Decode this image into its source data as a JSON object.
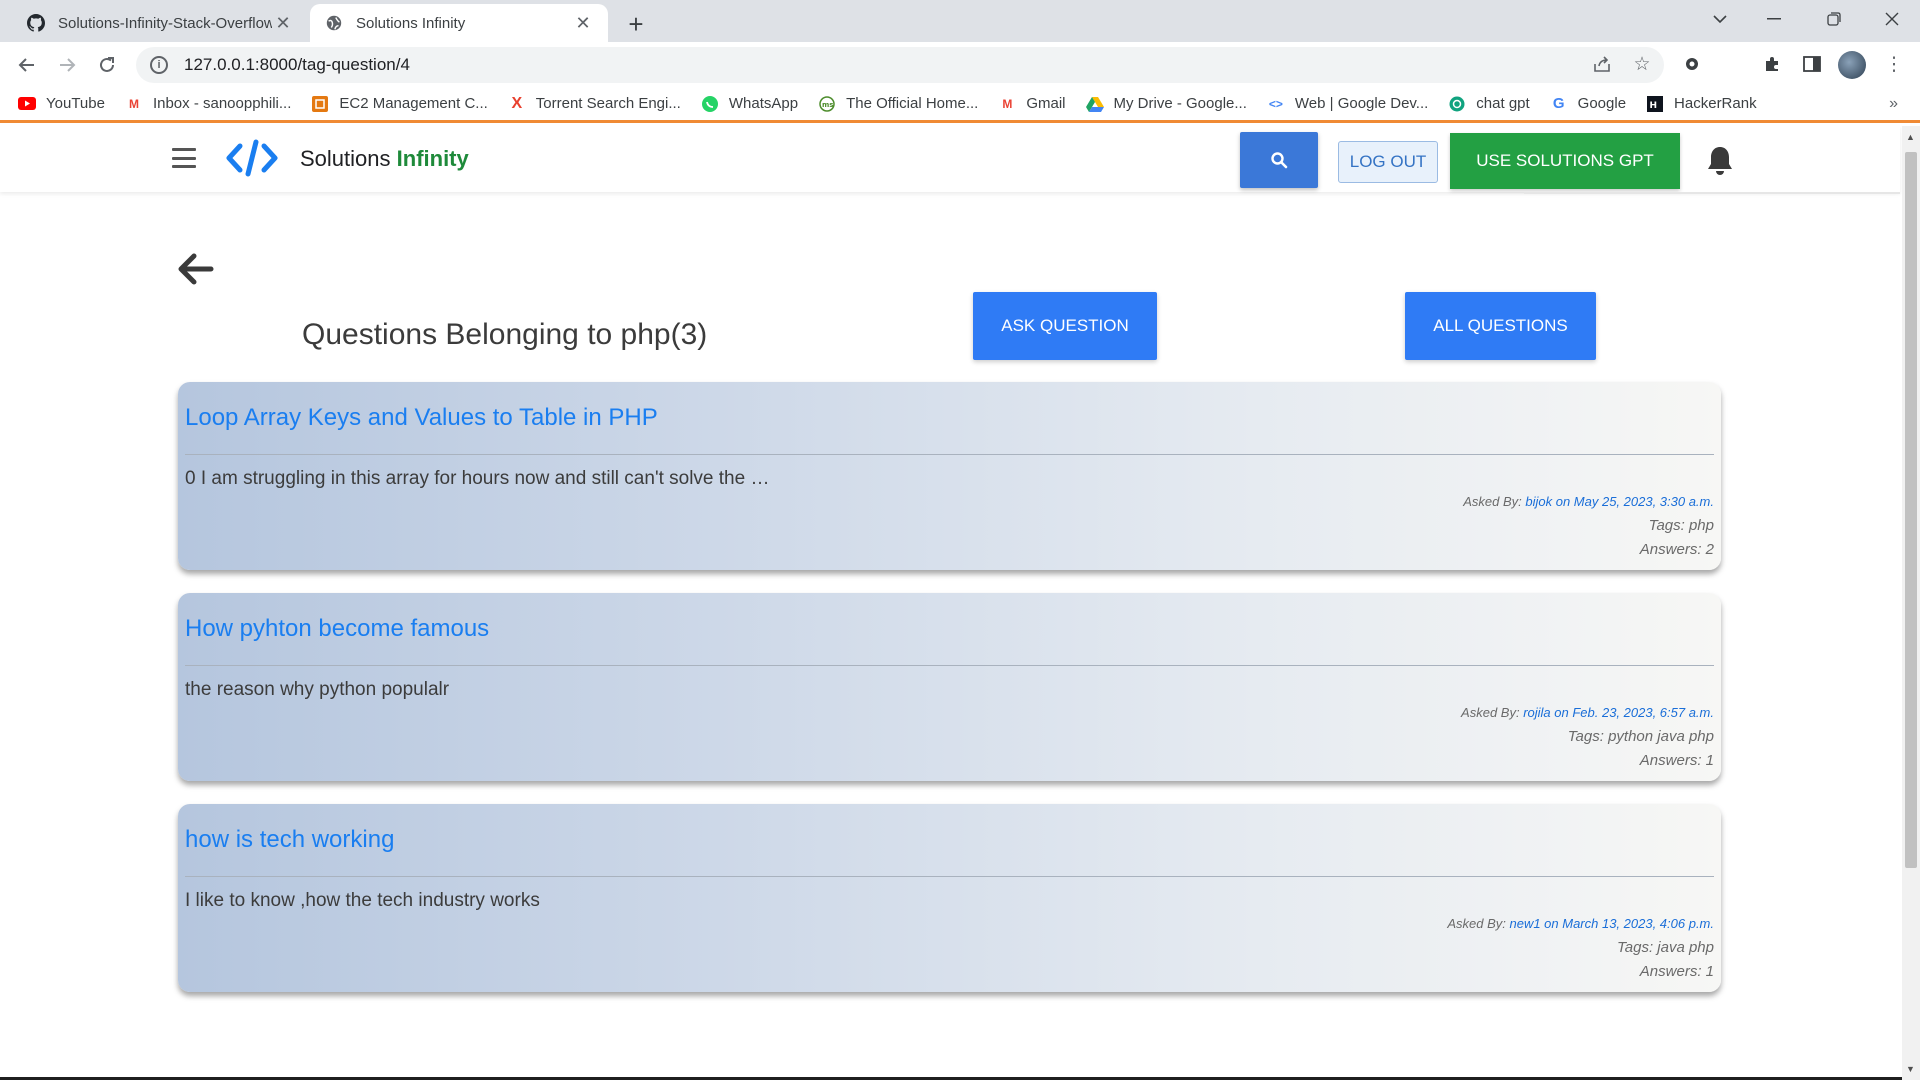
{
  "browser": {
    "tabs": [
      {
        "title": "Solutions-Infinity-Stack-Overflow",
        "icon": "github-icon",
        "active": false
      },
      {
        "title": "Solutions Infinity",
        "icon": "globe-icon",
        "active": true
      }
    ],
    "address": "127.0.0.1:8000/tag-question/4",
    "bookmarks": [
      {
        "label": "YouTube",
        "icon": "youtube-icon",
        "color": "#ff0000"
      },
      {
        "label": "Inbox - sanoopphili...",
        "icon": "gmail-icon",
        "color": "#ea4335"
      },
      {
        "label": "EC2 Management C...",
        "icon": "aws-icon",
        "color": "#e47911"
      },
      {
        "label": "Torrent Search Engi...",
        "icon": "torrent-icon",
        "color": "#e8402e"
      },
      {
        "label": "WhatsApp",
        "icon": "whatsapp-icon",
        "color": "#25d366"
      },
      {
        "label": "The Official Home...",
        "icon": "site-icon",
        "color": "#4c8c2b"
      },
      {
        "label": "Gmail",
        "icon": "gmail-icon",
        "color": "#ea4335"
      },
      {
        "label": "My Drive - Google...",
        "icon": "drive-icon",
        "color": "#1fa463"
      },
      {
        "label": "Web | Google Dev...",
        "icon": "code-icon",
        "color": "#4285f4"
      },
      {
        "label": "chat gpt",
        "icon": "openai-icon",
        "color": "#10a37f"
      },
      {
        "label": "Google",
        "icon": "google-icon",
        "color": "#4285f4"
      },
      {
        "label": "HackerRank",
        "icon": "hackerrank-icon",
        "color": "#1ba94c"
      }
    ]
  },
  "site": {
    "brand_prefix": "Solutions",
    "brand_accent": "Infinity",
    "logout_label": "LOG OUT",
    "gpt_label": "USE SOLUTIONS GPT",
    "accent_blue": "#3b78d8",
    "accent_green": "#23a043"
  },
  "page": {
    "title": "Questions Belonging to php(3)",
    "ask_label": "ASK QUESTION",
    "all_label": "ALL QUESTIONS"
  },
  "questions": [
    {
      "title": "Loop Array Keys and Values to Table in PHP",
      "excerpt": "0 I am struggling in this array for hours now and still can't solve the …",
      "asked_prefix": "Asked By:",
      "asked_by": "bijok on May 25, 2023, 3:30 a.m.",
      "tags": "Tags: php",
      "answers": "Answers: 2"
    },
    {
      "title": "How pyhton become famous",
      "excerpt": "the reason why python populalr",
      "asked_prefix": "Asked By:",
      "asked_by": "rojila on Feb. 23, 2023, 6:57 a.m.",
      "tags": "Tags: python java php",
      "answers": "Answers: 1"
    },
    {
      "title": "how is tech working",
      "excerpt": "I like to know ,how the tech industry works",
      "asked_prefix": "Asked By:",
      "asked_by": "new1 on March 13, 2023, 4:06 p.m.",
      "tags": "Tags: java php",
      "answers": "Answers: 1"
    }
  ]
}
